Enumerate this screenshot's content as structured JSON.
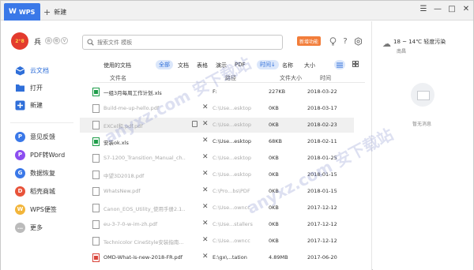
{
  "titlebar": {
    "app_tab": "WPS",
    "new_tab": "新建",
    "controls": [
      "☰",
      "—",
      "□",
      "✕"
    ]
  },
  "user": {
    "avatar_text": "2⁺8",
    "name": "兵"
  },
  "sidebar": {
    "primary": [
      {
        "label": "云文档",
        "icon": "cloud-doc-icon",
        "active": true
      },
      {
        "label": "打开",
        "icon": "folder-icon",
        "active": false
      },
      {
        "label": "新建",
        "icon": "plus-icon",
        "active": false
      }
    ],
    "tools": [
      {
        "label": "意见反馈",
        "icon": "feedback-icon",
        "color": "#3a78e8",
        "glyph": "P"
      },
      {
        "label": "PDF转Word",
        "icon": "pdf-icon",
        "color": "#8c4df0",
        "glyph": "P"
      },
      {
        "label": "数据恢复",
        "icon": "recover-icon",
        "color": "#3a78e8",
        "glyph": "G"
      },
      {
        "label": "稻壳商城",
        "icon": "mall-icon",
        "color": "#e8533a",
        "glyph": "D"
      },
      {
        "label": "WPS便签",
        "icon": "note-icon",
        "color": "#f2b53a",
        "glyph": "W"
      },
      {
        "label": "更多",
        "icon": "more-icon",
        "color": "#bbbbbb",
        "glyph": "…"
      }
    ]
  },
  "search": {
    "placeholder": "搜索文件 模板"
  },
  "header": {
    "new_feature_label": "新增功能"
  },
  "filters": {
    "recent_label": "使用的文档",
    "types": [
      "全部",
      "文档",
      "表格",
      "演示",
      "PDF"
    ],
    "sort": [
      "时间↓",
      "名称",
      "大小"
    ]
  },
  "columns": {
    "name": "文件名",
    "path": "路径",
    "size": "文件大小",
    "date": "时间"
  },
  "files": [
    {
      "name": "一组3月每周工作计划.xls",
      "path": "F:",
      "size": "227KB",
      "date": "2018-03-22",
      "type": "xls",
      "faded": false
    },
    {
      "name": "Build-me-up-hello.pdf",
      "path": "C:\\Use...esktop",
      "size": "0KB",
      "date": "2018-03-17",
      "type": "doc",
      "faded": true
    },
    {
      "name": "EXCel和.pdf.pdf",
      "path": "C:\\Use...esktop",
      "size": "0KB",
      "date": "2018-02-23",
      "type": "doc",
      "faded": true,
      "highlight": true
    },
    {
      "name": "安装ok.xls",
      "path": "C:\\Use...esktop",
      "size": "68KB",
      "date": "2018-02-11",
      "type": "xls",
      "faded": false
    },
    {
      "name": "S7-1200_Transition_Manual_ch...",
      "path": "C:\\Use...esktop",
      "size": "0KB",
      "date": "2018-01-25",
      "type": "doc",
      "faded": true
    },
    {
      "name": "中望3D2018.pdf",
      "path": "C:\\Use...esktop",
      "size": "0KB",
      "date": "2018-01-15",
      "type": "doc",
      "faded": true
    },
    {
      "name": "WhatsNew.pdf",
      "path": "C:\\Pro...bs\\PDF",
      "size": "0KB",
      "date": "2018-01-15",
      "type": "doc",
      "faded": true
    },
    {
      "name": "Canon_EOS_Utility_使用手册2.1...",
      "path": "C:\\Use...owncc",
      "size": "0KB",
      "date": "2017-12-12",
      "type": "doc",
      "faded": true
    },
    {
      "name": "eu-3-7-0-w-im-zh.pdf",
      "path": "C:\\Use...stallers",
      "size": "0KB",
      "date": "2017-12-12",
      "type": "doc",
      "faded": true
    },
    {
      "name": "Technicolor CineStyle安装指南...",
      "path": "C:\\Use...owncc",
      "size": "0KB",
      "date": "2017-12-12",
      "type": "doc",
      "faded": true
    },
    {
      "name": "OMD-What-is-new-2018-FR.pdf",
      "path": "E:\\gx\\...tation",
      "size": "4.89MB",
      "date": "2017-06-20",
      "type": "pdf",
      "faded": false
    }
  ],
  "right_panel": {
    "weather": "18 ~ 14℃ 轻度污染",
    "city": "南昌",
    "empty_message": "暂无消息"
  },
  "watermark": "anyxz.com 安下载站"
}
